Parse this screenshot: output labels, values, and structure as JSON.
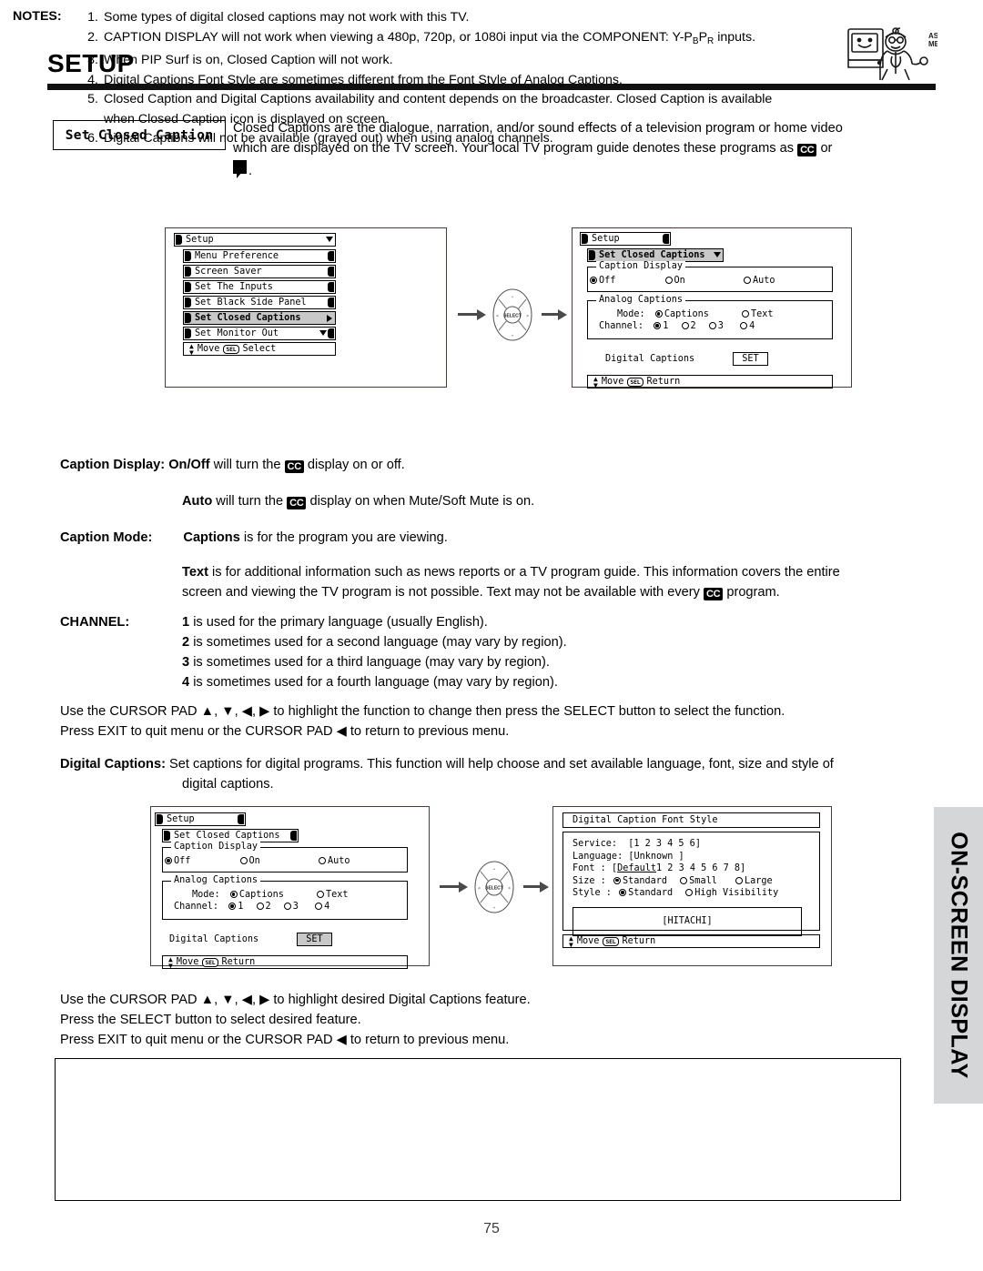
{
  "header": {
    "title": "SETUP",
    "mascot_alt": "ASK ME!",
    "mascot_line1": "ASK",
    "mascot_line2": "ME!"
  },
  "intro": {
    "box_label": "Set Closed Caption",
    "line1": "Closed Captions are the dialogue, narration, and/or sound effects of a television program or home video",
    "line2_a": "which are displayed on the TV screen.  Your local TV program guide denotes these programs as",
    "cc_badge": "CC",
    "line2_b": "or",
    "line3_tail": "."
  },
  "figure1": {
    "left_screen": {
      "title": "Setup",
      "items": [
        "Menu Preference",
        "Screen Saver",
        "Set The Inputs",
        "Set Black Side Panel",
        "Set Closed Captions",
        "Set Monitor Out"
      ],
      "selected_item": "Set Closed Captions",
      "footer_move": "Move",
      "footer_key": "SEL",
      "footer_action": "Select"
    },
    "cursor_pad_label": "SELECT",
    "right_screen": {
      "title": "Setup",
      "submenu": "Set Closed Captions",
      "caption_display_label": "Caption Display",
      "caption_display_options": [
        "Off",
        "On",
        "Auto"
      ],
      "caption_display_selected": "Off",
      "analog_captions_label": "Analog Captions",
      "mode_label": "Mode:",
      "mode_options": [
        "Captions",
        "Text"
      ],
      "mode_selected": "Captions",
      "channel_label": "Channel:",
      "channel_options": [
        "1",
        "2",
        "3",
        "4"
      ],
      "channel_selected": "1",
      "digital_captions_label": "Digital Captions",
      "digital_captions_button": "SET",
      "footer_move": "Move",
      "footer_key": "SEL",
      "footer_action": "Return"
    }
  },
  "body": {
    "caption_display_label": "Caption Display:",
    "caption_display_line1_a": "On/Off",
    "caption_display_line1_b": "will turn the",
    "caption_display_line1_c": "display on or off.",
    "caption_display_line2_a": "Auto",
    "caption_display_line2_b": "will turn the",
    "caption_display_line2_c": "display on when Mute/Soft Mute is on.",
    "caption_mode_label": "Caption Mode:",
    "caption_mode_line1_a": "Captions",
    "caption_mode_line1_b": "is for the program you are viewing.",
    "caption_mode_text_a": "Text",
    "caption_mode_text_b": "is for additional information such as news reports or a TV program guide.  This information covers the entire",
    "caption_mode_text_c": "screen and viewing the TV program is not possible.  Text may not be available with every",
    "caption_mode_text_d": "program.",
    "channel_label": "CHANNEL:",
    "channel_lines": [
      {
        "num": "1",
        "text": "is used for the primary language (usually English)."
      },
      {
        "num": "2",
        "text": "is sometimes used for a second language (may vary by region)."
      },
      {
        "num": "3",
        "text": "is sometimes used for a third language (may vary by region)."
      },
      {
        "num": "4",
        "text": "is sometimes used for a fourth language (may vary by region)."
      }
    ],
    "cursor_instr_1": "Use the CURSOR PAD ▲, ▼, ◀, ▶ to highlight the function to change then press the SELECT button to select the function.",
    "cursor_instr_2": "Press EXIT to quit menu or the CURSOR PAD ◀ to return to previous menu.",
    "digital_captions_label": "Digital Captions:",
    "digital_captions_line1": "Set captions for digital programs.  This function will help choose and set  available language, font, size and style of",
    "digital_captions_line2": "digital captions."
  },
  "figure2": {
    "left_screen": {
      "title": "Setup",
      "submenu": "Set Closed Captions",
      "caption_display_label": "Caption Display",
      "caption_display_options": [
        "Off",
        "On",
        "Auto"
      ],
      "caption_display_selected": "Off",
      "analog_captions_label": "Analog Captions",
      "mode_label": "Mode:",
      "mode_options": [
        "Captions",
        "Text"
      ],
      "mode_selected": "Captions",
      "channel_label": "Channel:",
      "channel_options": [
        "1",
        "2",
        "3",
        "4"
      ],
      "channel_selected": "1",
      "digital_captions_label": "Digital Captions",
      "digital_captions_button": "SET",
      "footer_move": "Move",
      "footer_key": "SEL",
      "footer_action": "Return"
    },
    "cursor_pad_label": "SELECT",
    "right_screen": {
      "title": "Digital Caption Font Style",
      "service_label": "Service:",
      "service_value": "[1 2 3 4 5 6]",
      "language_label": "Language:",
      "language_value": "[Unknown    ]",
      "font_label": "Font    :",
      "font_value_selected": "Default",
      "font_value_rest": "1 2 3 4 5 6 7 8]",
      "size_label": "Size    :",
      "size_options": [
        "Standard",
        "Small",
        "Large"
      ],
      "size_selected": "Standard",
      "style_label": "Style   :",
      "style_options": [
        "Standard",
        "High Visibility"
      ],
      "style_selected": "Standard",
      "preview_text": "[HITACHI]",
      "footer_move": "Move",
      "footer_key": "SEL",
      "footer_action": "Return"
    }
  },
  "body2": {
    "instr_1": "Use the CURSOR PAD ▲, ▼, ◀, ▶ to highlight desired Digital Captions feature.",
    "instr_2": "Press the SELECT button to select desired feature.",
    "instr_3": "Press EXIT to quit menu or the CURSOR PAD ◀ to return to previous menu."
  },
  "notes": {
    "label": "NOTES:",
    "items": [
      {
        "num": "1.",
        "text": "Some types of digital closed captions may not work with this TV."
      },
      {
        "num": "2.",
        "text": "CAPTION DISPLAY will not work when viewing a 480p, 720p, or 1080i input via the COMPONENT: Y-PBPR inputs."
      },
      {
        "num": "3.",
        "text": "When PIP Surf is on, Closed Caption will not work."
      },
      {
        "num": "4.",
        "text": "Digital Captions Font Style are sometimes different from the Font Style of Analog Captions."
      },
      {
        "num": "5.",
        "text": "Closed Caption and Digital Captions availability and content depends on the broadcaster.  Closed Caption is available when Closed Caption icon is displayed on screen."
      },
      {
        "num": "6.",
        "text": "Digital Captions will not be available (grayed out) when using analog channels."
      }
    ]
  },
  "side_tab": {
    "text": "ON-SCREEN DISPLAY"
  },
  "page_number": "75",
  "colors": {
    "rule": "#111111",
    "panel_border": "#4a3a3a",
    "selected_bg": "#c8c8c8",
    "side_tab_bg": "#d4d6d8",
    "arrow": "#4a4a4a"
  }
}
